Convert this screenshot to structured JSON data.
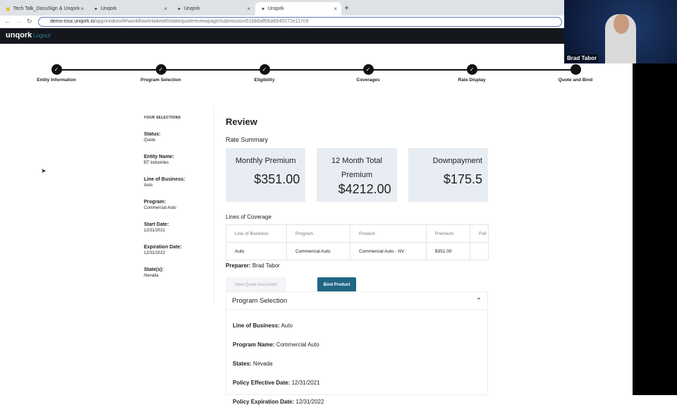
{
  "browser": {
    "tabs": [
      {
        "label": "Tech Talk_DocuSign & Unqork"
      },
      {
        "label": "Unqork"
      },
      {
        "label": "Unqork"
      },
      {
        "label": "Unqork",
        "active": true
      }
    ],
    "url_domain": "demo-insx.unqork.io",
    "url_path": "/app/intakewf#/workflow/intakewf/intakequotereviewpage/submission/61bb6aff0ba6540172e117c9"
  },
  "app": {
    "logo": "unqork",
    "logout": "Logout"
  },
  "webcam": {
    "name": "Brad Tabor"
  },
  "steps": [
    "Entity Information",
    "Program Selection",
    "Eligibility",
    "Coverages",
    "Rate Display",
    "Quote and Bind"
  ],
  "sidebar": {
    "heading": "YOUR SELECTIONS",
    "items": [
      {
        "k": "Status:",
        "v": "Quote"
      },
      {
        "k": "Entity Name:",
        "v": "BT Industries"
      },
      {
        "k": "Line of Business:",
        "v": "Auto"
      },
      {
        "k": "Program:",
        "v": "Commercial Auto"
      },
      {
        "k": "Start Date:",
        "v": "12/31/2021"
      },
      {
        "k": "Expiration Date:",
        "v": "12/31/2022"
      },
      {
        "k": "State(s):",
        "v": "Nevada"
      }
    ]
  },
  "review": {
    "title": "Review",
    "rate_summary": "Rate Summary",
    "cards": [
      {
        "t": "Monthly Premium",
        "a": "$351.00"
      },
      {
        "t": "12 Month Total Premium",
        "a": "$4212.00"
      },
      {
        "t": "Downpayment",
        "a": "$175.5"
      }
    ],
    "loc_title": "Lines of Coverage",
    "headers": [
      "Line of Business",
      "Program",
      "Product",
      "Premium",
      "Poli"
    ],
    "row": [
      "Auto",
      "Commercial Auto",
      "Commercial Auto - NV",
      "$351.00",
      ""
    ],
    "preparer_label": "Preparer:",
    "preparer": "Brad Tabor",
    "view_btn": "View Quote Document",
    "bind_btn": "Bind Product"
  },
  "program": {
    "title": "Program Selection",
    "rows": [
      {
        "k": "Line of Business:",
        "v": "Auto"
      },
      {
        "k": "Program Name:",
        "v": "Commercial Auto"
      },
      {
        "k": "States:",
        "v": "Nevada"
      },
      {
        "k": "Policy Effective Date:",
        "v": "12/31/2021"
      },
      {
        "k": "Policy Expiration Date:",
        "v": "12/31/2022"
      }
    ]
  }
}
